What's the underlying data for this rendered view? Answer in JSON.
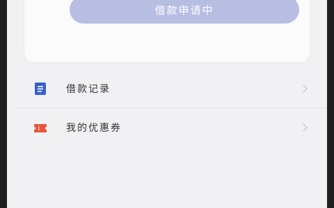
{
  "apply_button": {
    "label": "借款申请中"
  },
  "menu": {
    "items": [
      {
        "label": "借款记录",
        "icon": "document-icon",
        "icon_color": "#3a5fcd"
      },
      {
        "label": "我的优惠券",
        "icon": "ticket-icon",
        "icon_color": "#e8553c"
      }
    ]
  },
  "colors": {
    "screen_bg": "#f1f0f3",
    "button_bg": "#b8bde2",
    "text": "#333333"
  }
}
